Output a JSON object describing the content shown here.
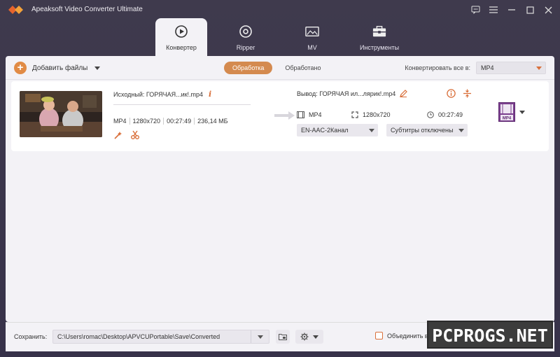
{
  "app": {
    "title": "Apeaksoft Video Converter Ultimate"
  },
  "tabs": [
    {
      "label": "Конвертер",
      "icon": "converter-icon",
      "active": true
    },
    {
      "label": "Ripper",
      "icon": "ripper-disc-icon",
      "active": false
    },
    {
      "label": "MV",
      "icon": "mv-image-icon",
      "active": false
    },
    {
      "label": "Инструменты",
      "icon": "toolbox-icon",
      "active": false
    }
  ],
  "toolbar": {
    "add_files_label": "Добавить файлы",
    "segment": {
      "processing": "Обработка",
      "processed": "Обработано",
      "active": "processing"
    },
    "convert_all_label": "Конвертировать все в:",
    "convert_all_value": "MP4"
  },
  "file": {
    "source_name": "Исходный: ГОРЯЧАЯ...ик!.mp4",
    "source_meta": [
      "MP4",
      "1280x720",
      "00:27:49",
      "236,14 МБ"
    ],
    "output_name": "Вывод: ГОРЯЧАЯ ил...лярик!.mp4",
    "output_format": "MP4",
    "output_resolution": "1280x720",
    "output_duration": "00:27:49",
    "audio_track": "EN-AAC-2Канал",
    "subtitles": "Субтитры отключены",
    "format_badge": "MP4"
  },
  "bottom": {
    "save_label": "Сохранить:",
    "save_path": "C:\\Users\\romac\\Desktop\\APVCUPortable\\Save\\Converted",
    "merge_label": "Объединить в один ф"
  },
  "watermark": "PCPROGS.NET",
  "colors": {
    "accent": "#d96f3a",
    "titlebar": "#3f3a4d",
    "panel": "#f3f2f6"
  }
}
